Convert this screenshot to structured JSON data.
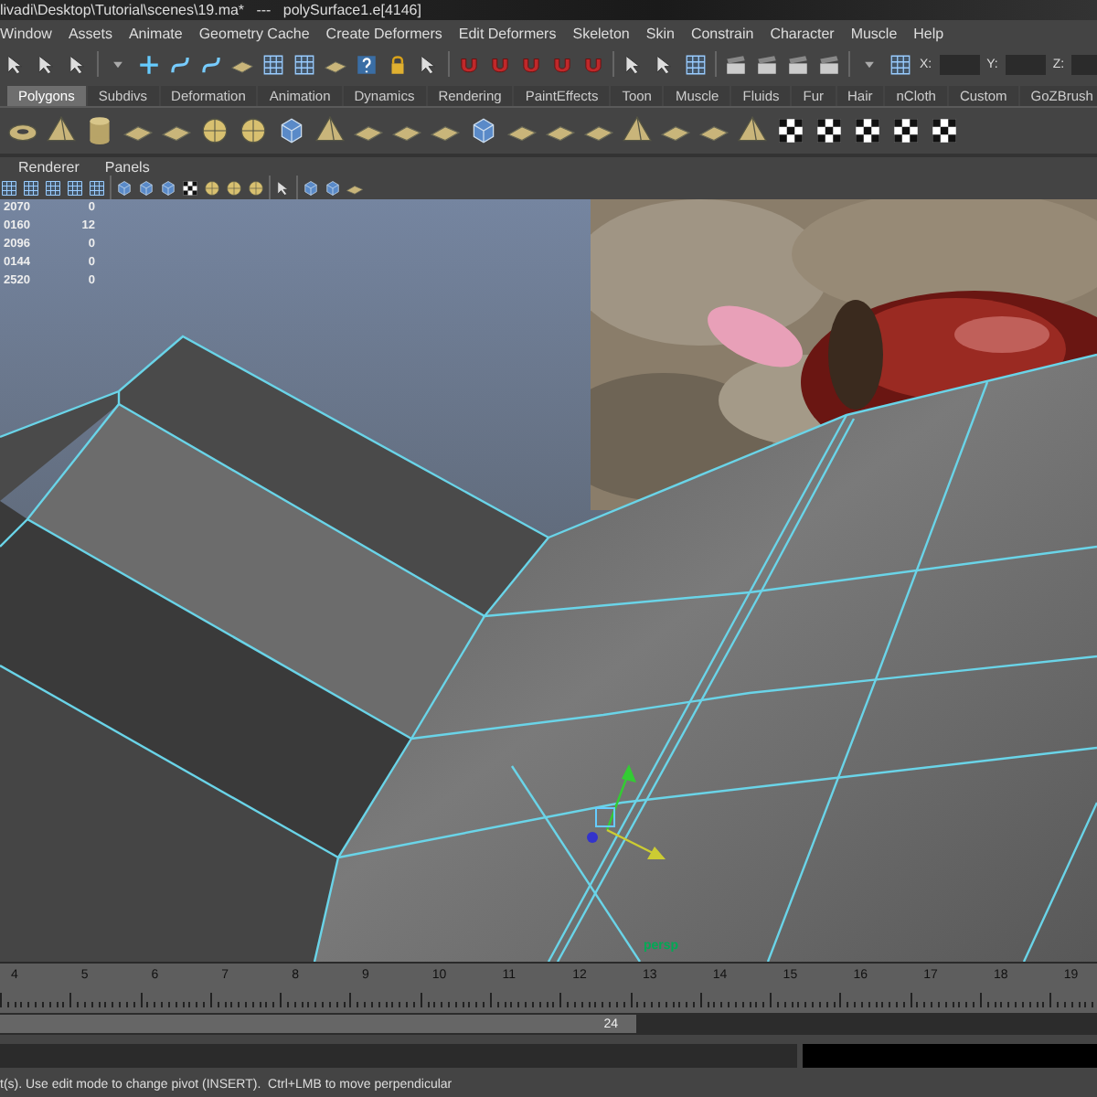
{
  "window": {
    "title": "livadi\\Desktop\\Tutorial\\scenes\\19.ma*   ---   polySurface1.e[4146]"
  },
  "menu": [
    "Window",
    "Assets",
    "Animate",
    "Geometry Cache",
    "Create Deformers",
    "Edit Deformers",
    "Skeleton",
    "Skin",
    "Constrain",
    "Character",
    "Muscle",
    "Help"
  ],
  "status_line": {
    "fields": [
      {
        "label": "X:"
      },
      {
        "label": "Y:"
      },
      {
        "label": "Z:"
      }
    ]
  },
  "shelf": {
    "tabs": [
      {
        "label": "Polygons",
        "selected": true
      },
      {
        "label": "Subdivs",
        "selected": false
      },
      {
        "label": "Deformation",
        "selected": false
      },
      {
        "label": "Animation",
        "selected": false
      },
      {
        "label": "Dynamics",
        "selected": false
      },
      {
        "label": "Rendering",
        "selected": false
      },
      {
        "label": "PaintEffects",
        "selected": false
      },
      {
        "label": "Toon",
        "selected": false
      },
      {
        "label": "Muscle",
        "selected": false
      },
      {
        "label": "Fluids",
        "selected": false
      },
      {
        "label": "Fur",
        "selected": false
      },
      {
        "label": "Hair",
        "selected": false
      },
      {
        "label": "nCloth",
        "selected": false
      },
      {
        "label": "Custom",
        "selected": false
      },
      {
        "label": "GoZBrush",
        "selected": false
      }
    ]
  },
  "panel_menu": [
    "Renderer",
    "Panels"
  ],
  "hud": {
    "rows": [
      {
        "column_1": "2070",
        "column_2": "0"
      },
      {
        "column_1": "0160",
        "column_2": "12"
      },
      {
        "column_1": "2096",
        "column_2": "0"
      },
      {
        "column_1": "0144",
        "column_2": "0"
      },
      {
        "column_1": "2520",
        "column_2": "0"
      }
    ]
  },
  "viewport": {
    "camera": "persp"
  },
  "time_slider": {
    "ticks": [
      "4",
      "5",
      "6",
      "7",
      "8",
      "9",
      "10",
      "11",
      "12",
      "13",
      "14",
      "15",
      "16",
      "17",
      "18",
      "19"
    ]
  },
  "range_slider": {
    "end": "24",
    "level": 0.58
  },
  "help_line": "t(s). Use edit mode to change pivot (INSERT).  Ctrl+LMB to move perpendicular"
}
